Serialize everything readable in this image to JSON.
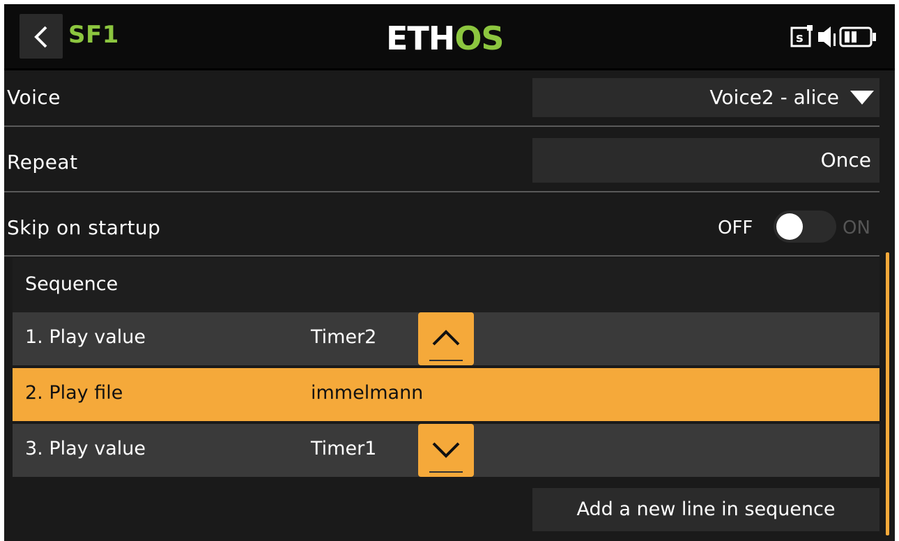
{
  "header": {
    "title": "SF1",
    "logo_part1": "ETH",
    "logo_part2": "OS",
    "accent_color": "#8cc63f"
  },
  "rows": {
    "voice": {
      "label": "Voice",
      "value": "Voice2 - alice"
    },
    "repeat": {
      "label": "Repeat",
      "value": "Once"
    },
    "skip_startup": {
      "label": "Skip on startup",
      "off_label": "OFF",
      "on_label": "ON",
      "state": "off"
    }
  },
  "sequence": {
    "title": "Sequence",
    "items": [
      {
        "label": "1. Play value",
        "value": "Timer2",
        "control": "move-up"
      },
      {
        "label": "2. Play file",
        "value": "immelmann",
        "selected": true
      },
      {
        "label": "3. Play value",
        "value": "Timer1",
        "control": "move-down"
      }
    ],
    "add_label": "Add a new line in sequence"
  },
  "status_icons": [
    "sd-card-icon",
    "speaker-icon",
    "battery-icon"
  ],
  "colors": {
    "highlight": "#f5a93a",
    "background": "#1a1a1a",
    "panel": "#2b2b2b"
  }
}
